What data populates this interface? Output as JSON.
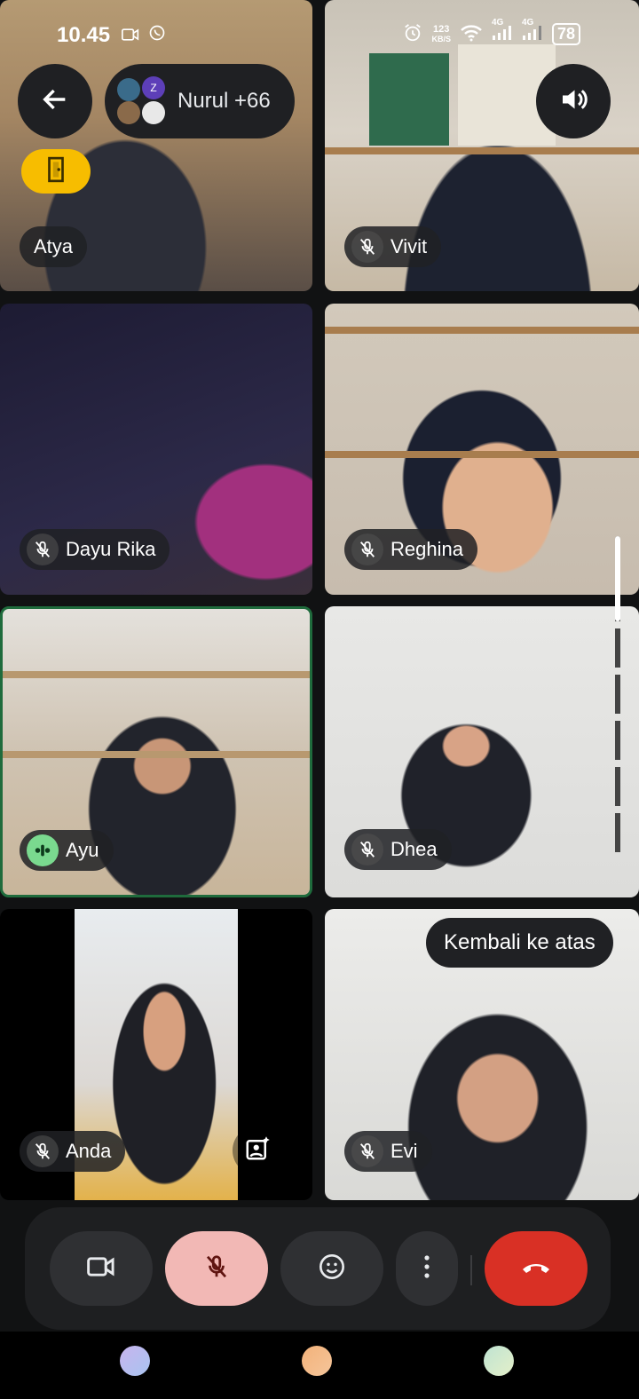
{
  "status_bar": {
    "time": "10.45",
    "data_speed_value": "123",
    "data_speed_unit": "KB/S",
    "network_1": "4G",
    "network_2": "4G",
    "battery": "78"
  },
  "header": {
    "back_icon": "arrow-left-icon",
    "participants_label": "Nurul +66",
    "speaker_icon": "volume-up-icon",
    "leave_icon": "door-exit-icon"
  },
  "tiles": [
    {
      "name": "Atya",
      "mic": "none"
    },
    {
      "name": "Vivit",
      "mic": "muted"
    },
    {
      "name": "Dayu Rika",
      "mic": "muted"
    },
    {
      "name": "Reghina",
      "mic": "muted"
    },
    {
      "name": "Ayu",
      "mic": "speaking"
    },
    {
      "name": "Dhea",
      "mic": "muted"
    },
    {
      "name": "Anda",
      "mic": "muted"
    },
    {
      "name": "Evi",
      "mic": "muted"
    }
  ],
  "tooltip": "Kembali ke atas",
  "controls": {
    "camera_icon": "video-camera-icon",
    "mic_icon": "mic-off-icon",
    "emoji_icon": "emoji-icon",
    "more_icon": "more-vertical-icon",
    "end_icon": "end-call-icon"
  },
  "colors": {
    "background": "#111213",
    "speaking_border": "#1f6b3c",
    "mic_button_active": "#f2b8b5",
    "end_call": "#d93025",
    "leave_button": "#f7bd00"
  },
  "nav_dots": [
    "#c8b4ee",
    "#f3b27a",
    "#bfe3d2"
  ]
}
